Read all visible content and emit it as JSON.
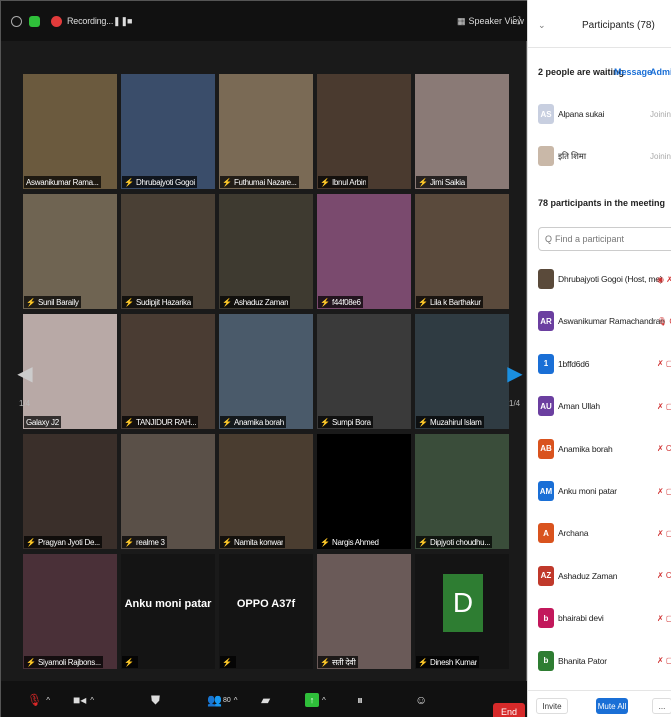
{
  "topbar": {
    "recording_label": "Recording...",
    "speaker_view_label": "Speaker View"
  },
  "grid": {
    "page_indicator": "1/4",
    "tiles": [
      {
        "name": "Aswanikumar Rama...",
        "muted": false,
        "active": true,
        "color": "#6b5a3e"
      },
      {
        "name": "Dhrubajyoti Gogoi",
        "muted": true,
        "active": false,
        "color": "#3a4d6a"
      },
      {
        "name": "Futhumai Nazare...",
        "muted": true,
        "active": false,
        "color": "#7a6a55"
      },
      {
        "name": "Ibnul Arbin",
        "muted": true,
        "active": false,
        "color": "#4a3a2f"
      },
      {
        "name": "Jimi Saikia",
        "muted": true,
        "active": false,
        "color": "#8a7a76"
      },
      {
        "name": "Sunil Baraily",
        "muted": true,
        "active": false,
        "color": "#6f6452"
      },
      {
        "name": "Sudipjit Hazarika",
        "muted": true,
        "active": false,
        "color": "#4a4035"
      },
      {
        "name": "Ashaduz Zaman",
        "muted": true,
        "active": false,
        "color": "#3e3a30"
      },
      {
        "name": "f44f08e6",
        "muted": true,
        "active": false,
        "color": "#7a4a6e"
      },
      {
        "name": "Lila k Barthakur",
        "muted": true,
        "active": false,
        "color": "#5a4a3c"
      },
      {
        "name": "Galaxy J2",
        "muted": false,
        "active": false,
        "color": "#b8a9a6"
      },
      {
        "name": "TANJIDUR RAH...",
        "muted": true,
        "active": false,
        "color": "#4a3c33"
      },
      {
        "name": "Anamika borah",
        "muted": true,
        "active": false,
        "color": "#4a5a6a"
      },
      {
        "name": "Sumpi Bora",
        "muted": true,
        "active": false,
        "color": "#3a3a3a"
      },
      {
        "name": "Muzahirul Islam",
        "muted": true,
        "active": false,
        "color": "#2f3b42"
      },
      {
        "name": "Pragyan Jyoti De...",
        "muted": true,
        "active": false,
        "color": "#3a2f2a"
      },
      {
        "name": "realme 3",
        "muted": true,
        "active": false,
        "color": "#5a5048"
      },
      {
        "name": "Namita konwar",
        "muted": true,
        "active": false,
        "color": "#4a3d30"
      },
      {
        "name": "Nargis Ahmed",
        "muted": true,
        "active": false,
        "color": "#000000"
      },
      {
        "name": "Dipjyoti choudhu...",
        "muted": true,
        "active": false,
        "color": "#3a4d3a"
      },
      {
        "name": "Siyamoli Rajbons...",
        "muted": true,
        "active": false,
        "color": "#4a3038"
      },
      {
        "name": "",
        "muted": true,
        "active": false,
        "color": "#141414",
        "big_name": "Anku moni patar"
      },
      {
        "name": "",
        "muted": true,
        "active": false,
        "color": "#141414",
        "big_name": "OPPO A37f"
      },
      {
        "name": "सती देवी",
        "muted": true,
        "active": false,
        "color": "#6a5a58"
      },
      {
        "name": "Dinesh Kumar",
        "muted": true,
        "active": false,
        "color": "#141414",
        "letter": "D"
      }
    ]
  },
  "bottombar": {
    "participants_count": "80",
    "end_label": "End"
  },
  "panel": {
    "title": "Participants (78)",
    "waiting_header": "2 people are waiting",
    "message_link": "Message",
    "admit_link": "Admit a",
    "waiting": [
      {
        "name": "Alpana sukai",
        "initials": "AS",
        "status": "Joining",
        "color": "#c8cfe0"
      },
      {
        "name": "इति शिमा",
        "initials": "",
        "status": "Joining",
        "color": "#c9b8a8"
      }
    ],
    "in_meeting_header": "78 participants in the meeting",
    "find_placeholder": "Find a participant",
    "participants": [
      {
        "name": "Dhrubajyoti Gogoi (Host, me)",
        "initials": "",
        "color": "#5a4a3a",
        "icons": "◉ ✗ C"
      },
      {
        "name": "Aswanikumar Ramachandran",
        "initials": "AR",
        "color": "#6b3fa0",
        "icons": "🎙 C"
      },
      {
        "name": "1bffd6d6",
        "initials": "1",
        "color": "#1a6fd6",
        "icons": "✗ ▢"
      },
      {
        "name": "Aman Ullah",
        "initials": "AU",
        "color": "#6b3fa0",
        "icons": "✗ ▢"
      },
      {
        "name": "Anamika borah",
        "initials": "AB",
        "color": "#d9531e",
        "icons": "✗ C"
      },
      {
        "name": "Anku moni patar",
        "initials": "AM",
        "color": "#1a6fd6",
        "icons": "✗ ▢"
      },
      {
        "name": "Archana",
        "initials": "A",
        "color": "#d9531e",
        "icons": "✗ ▢"
      },
      {
        "name": "Ashaduz Zaman",
        "initials": "AZ",
        "color": "#c0392b",
        "icons": "✗ C"
      },
      {
        "name": "bhairabi devi",
        "initials": "b",
        "color": "#c2185b",
        "icons": "✗ ▢"
      },
      {
        "name": "Bhanita Pator",
        "initials": "b",
        "color": "#2e7d32",
        "icons": "✗ ▢"
      }
    ],
    "invite_label": "Invite",
    "mute_all_label": "Mute All",
    "more_label": "..."
  }
}
